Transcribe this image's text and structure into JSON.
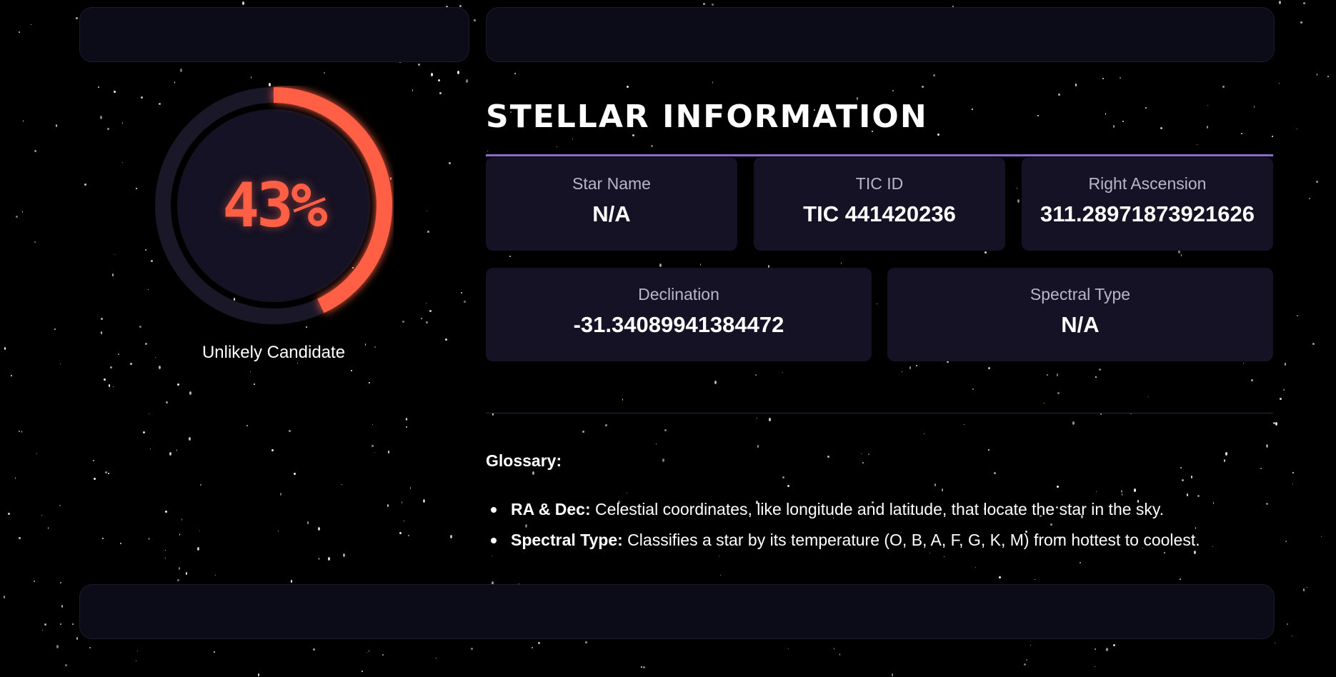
{
  "score": {
    "percent_text": "43%",
    "fraction": 0.43,
    "verdict": "Unlikely Candidate",
    "ring_color": "#ff5f45",
    "track_color": "#1a1828"
  },
  "stellar": {
    "title": "STELLAR INFORMATION",
    "accent_color": "#8e6bd4",
    "star_name": {
      "label": "Star Name",
      "value": "N/A"
    },
    "tic_id": {
      "label": "TIC ID",
      "value": "TIC 441420236"
    },
    "right_ascension": {
      "label": "Right Ascension",
      "value": "311.28971873921626"
    },
    "declination": {
      "label": "Declination",
      "value": "-31.34089941384472"
    },
    "spectral_type": {
      "label": "Spectral Type",
      "value": "N/A"
    }
  },
  "glossary": {
    "title": "Glossary:",
    "items": [
      {
        "term": "RA & Dec:",
        "definition": " Celestial coordinates, like longitude and latitude, that locate the star in the sky."
      },
      {
        "term": "Spectral Type:",
        "definition": " Classifies a star by its temperature (O, B, A, F, G, K, M) from hottest to coolest."
      }
    ]
  }
}
